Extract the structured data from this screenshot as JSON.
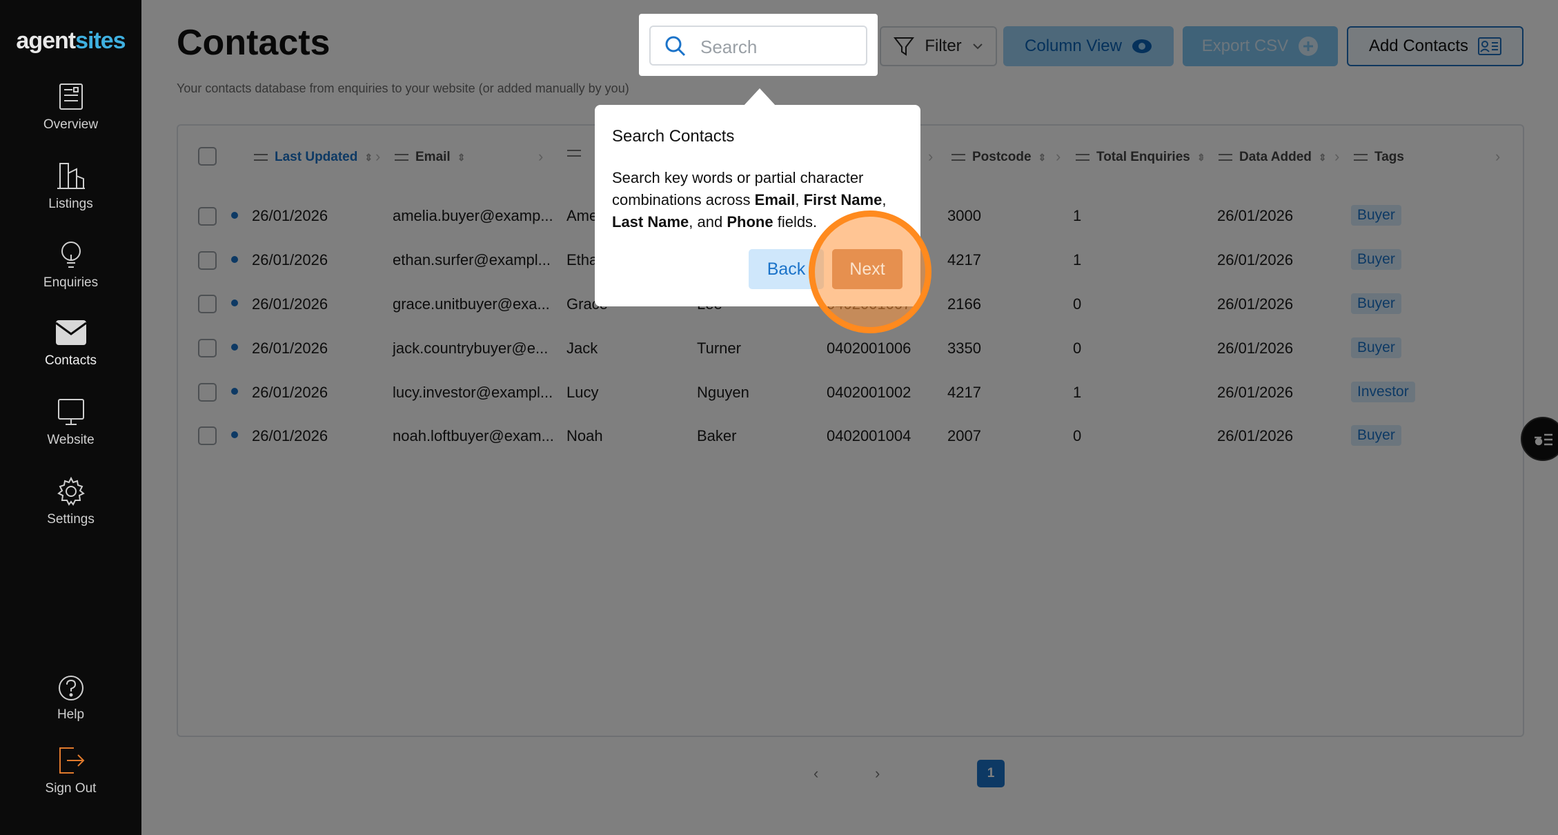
{
  "brand": {
    "part1": "agent",
    "part2": "sites"
  },
  "sidebar": {
    "items": [
      {
        "label": "Overview",
        "icon": "newspaper-icon"
      },
      {
        "label": "Listings",
        "icon": "buildings-icon"
      },
      {
        "label": "Enquiries",
        "icon": "lightbulb-icon"
      },
      {
        "label": "Contacts",
        "icon": "envelope-icon"
      },
      {
        "label": "Website",
        "icon": "monitor-icon"
      },
      {
        "label": "Settings",
        "icon": "gear-icon"
      }
    ],
    "bottom": [
      {
        "label": "Help",
        "icon": "help-icon"
      },
      {
        "label": "Sign Out",
        "icon": "sign-out-icon"
      }
    ]
  },
  "header": {
    "title": "Contacts",
    "subtitle": "Your contacts database from enquiries to your website (or added manually by you)",
    "search_placeholder": "Search",
    "filter_label": "Filter",
    "column_view_label": "Column View",
    "export_label": "Export CSV",
    "add_contacts_label": "Add Contacts"
  },
  "table": {
    "columns": [
      "Last Updated",
      "Email",
      "",
      "Postcode",
      "Total Enquiries",
      "Data Added",
      "Tags"
    ],
    "rows": [
      {
        "updated": "26/01/2026",
        "email": "amelia.buyer@examp...",
        "first": "Ame",
        "last": "",
        "phone": "",
        "postcode": "3000",
        "enquiries": "1",
        "added": "26/01/2026",
        "tag": "Buyer"
      },
      {
        "updated": "26/01/2026",
        "email": "ethan.surfer@exampl...",
        "first": "Etha",
        "last": "",
        "phone": "",
        "postcode": "4217",
        "enquiries": "1",
        "added": "26/01/2026",
        "tag": "Buyer"
      },
      {
        "updated": "26/01/2026",
        "email": "grace.unitbuyer@exa...",
        "first": "Grace",
        "last": "Lee",
        "phone": "0402001007",
        "postcode": "2166",
        "enquiries": "0",
        "added": "26/01/2026",
        "tag": "Buyer"
      },
      {
        "updated": "26/01/2026",
        "email": "jack.countrybuyer@e...",
        "first": "Jack",
        "last": "Turner",
        "phone": "0402001006",
        "postcode": "3350",
        "enquiries": "0",
        "added": "26/01/2026",
        "tag": "Buyer"
      },
      {
        "updated": "26/01/2026",
        "email": "lucy.investor@exampl...",
        "first": "Lucy",
        "last": "Nguyen",
        "phone": "0402001002",
        "postcode": "4217",
        "enquiries": "1",
        "added": "26/01/2026",
        "tag": "Investor"
      },
      {
        "updated": "26/01/2026",
        "email": "noah.loftbuyer@exam...",
        "first": "Noah",
        "last": "Baker",
        "phone": "0402001004",
        "postcode": "2007",
        "enquiries": "0",
        "added": "26/01/2026",
        "tag": "Buyer"
      }
    ]
  },
  "pagination": {
    "current": "1",
    "prev": "‹",
    "next": "›"
  },
  "tour": {
    "title": "Search Contacts",
    "body_intro": "Search key words or partial character combinations across",
    "field1": "Email",
    "field2": "First Name",
    "field3": "Last Name",
    "and": ", and",
    "field4": "Phone",
    "body_outro": "fields.",
    "back_label": "Back",
    "next_label": "Next"
  },
  "colors": {
    "accent": "#1b73c9",
    "highlight": "#ff8a1e",
    "sidebar": "#0b0b0b"
  }
}
